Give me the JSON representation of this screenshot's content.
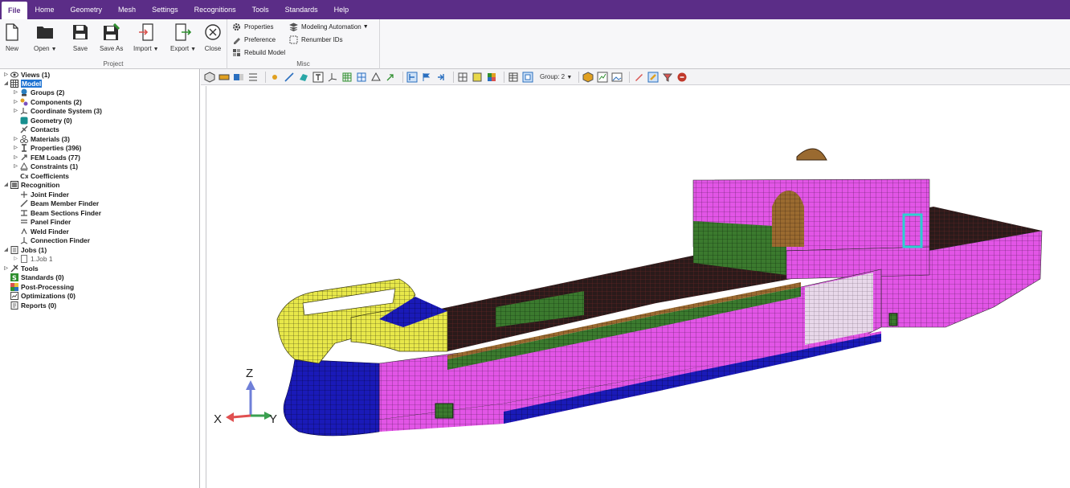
{
  "menu": [
    "File",
    "Home",
    "Geometry",
    "Mesh",
    "Settings",
    "Recognitions",
    "Tools",
    "Standards",
    "Help"
  ],
  "ribbon": {
    "project": {
      "label": "Project",
      "new": "New",
      "open": "Open",
      "save": "Save",
      "save_as": "Save As",
      "import": "Import",
      "export": "Export",
      "close": "Close"
    },
    "misc": {
      "label": "Misc",
      "properties": "Properties",
      "preference": "Preference",
      "rebuild_model": "Rebuild Model",
      "modeling_automation": "Modeling Automation",
      "renumber_ids": "Renumber IDs"
    }
  },
  "tree": {
    "views": "Views (1)",
    "model": "Model",
    "groups": "Groups (2)",
    "components": "Components (2)",
    "coordinate_system": "Coordinate System (3)",
    "geometry": "Geometry (0)",
    "contacts": "Contacts",
    "materials": "Materials (3)",
    "properties": "Properties (396)",
    "fem_loads": "FEM Loads (77)",
    "constraints": "Constraints (1)",
    "coefficients": "Coefficients",
    "recognition": "Recognition",
    "joint_finder": "Joint Finder",
    "beam_member_finder": "Beam Member Finder",
    "beam_sections_finder": "Beam Sections Finder",
    "panel_finder": "Panel Finder",
    "weld_finder": "Weld Finder",
    "connection_finder": "Connection Finder",
    "jobs": "Jobs (1)",
    "job1": "1.Job 1",
    "tools": "Tools",
    "standards": "Standards (0)",
    "post_processing": "Post-Processing",
    "optimizations": "Optimizations (0)",
    "reports": "Reports (0)"
  },
  "viewport_toolbar": {
    "group_selector": "Group: 2"
  },
  "triad": {
    "z": "Z",
    "x": "X",
    "y": "Y"
  },
  "colors": {
    "menubar": "#5b2d87",
    "hull_magenta": "#e255e6",
    "bow_yellow": "#e8e84a",
    "bow_blue": "#1a1ab8",
    "deck_green": "#3b7a2e",
    "mesh_line": "#2a2a2a"
  }
}
